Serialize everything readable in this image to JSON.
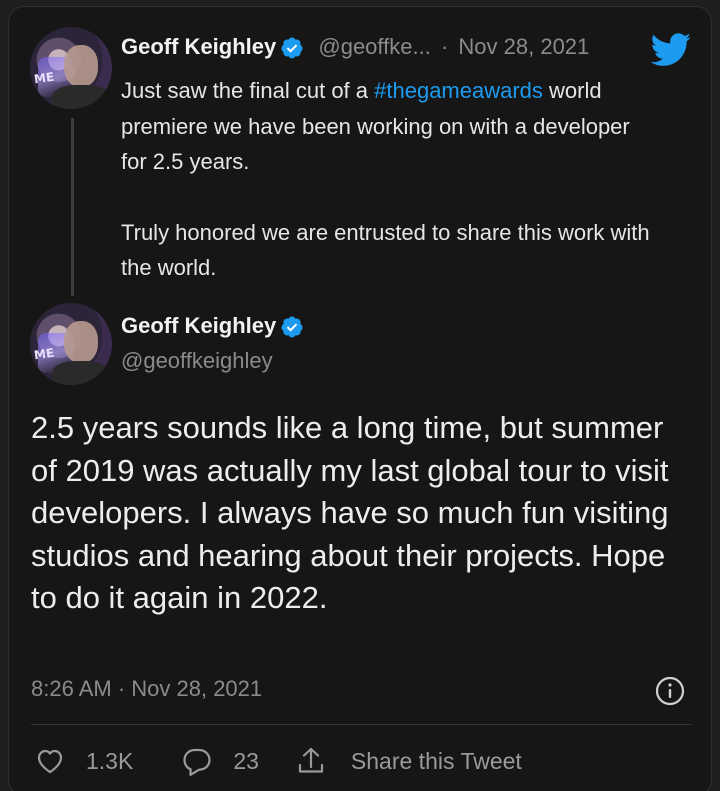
{
  "thread_tweet": {
    "name": "Geoff Keighley",
    "handle": "@geoffke...",
    "separator": "·",
    "date": "Nov 28, 2021",
    "text_before_hashtag": "Just saw the final cut of a ",
    "hashtag": "#thegameawards",
    "text_after_hashtag": " world premiere we have been working on with a developer for 2.5 years.",
    "paragraph2": "Truly honored we are entrusted to share this work with the world."
  },
  "main_tweet": {
    "name": "Geoff Keighley",
    "handle": "@geoffkeighley",
    "text": "2.5 years sounds like a long time, but summer of 2019 was actually my last global tour to visit developers. I always have so much fun visiting studios and hearing about their projects. Hope to do it again in 2022.",
    "timestamp": "8:26 AM · Nov 28, 2021"
  },
  "actions": {
    "likes": "1.3K",
    "replies": "23",
    "share_label": "Share this Tweet"
  },
  "colors": {
    "accent": "#1d9bf0",
    "background": "#161616",
    "muted": "#8b8b8b"
  },
  "icons": {
    "verified": "verified-badge-icon",
    "bird": "twitter-bird-icon",
    "info": "info-icon",
    "like": "heart-icon",
    "reply": "comment-icon",
    "share": "share-icon"
  }
}
